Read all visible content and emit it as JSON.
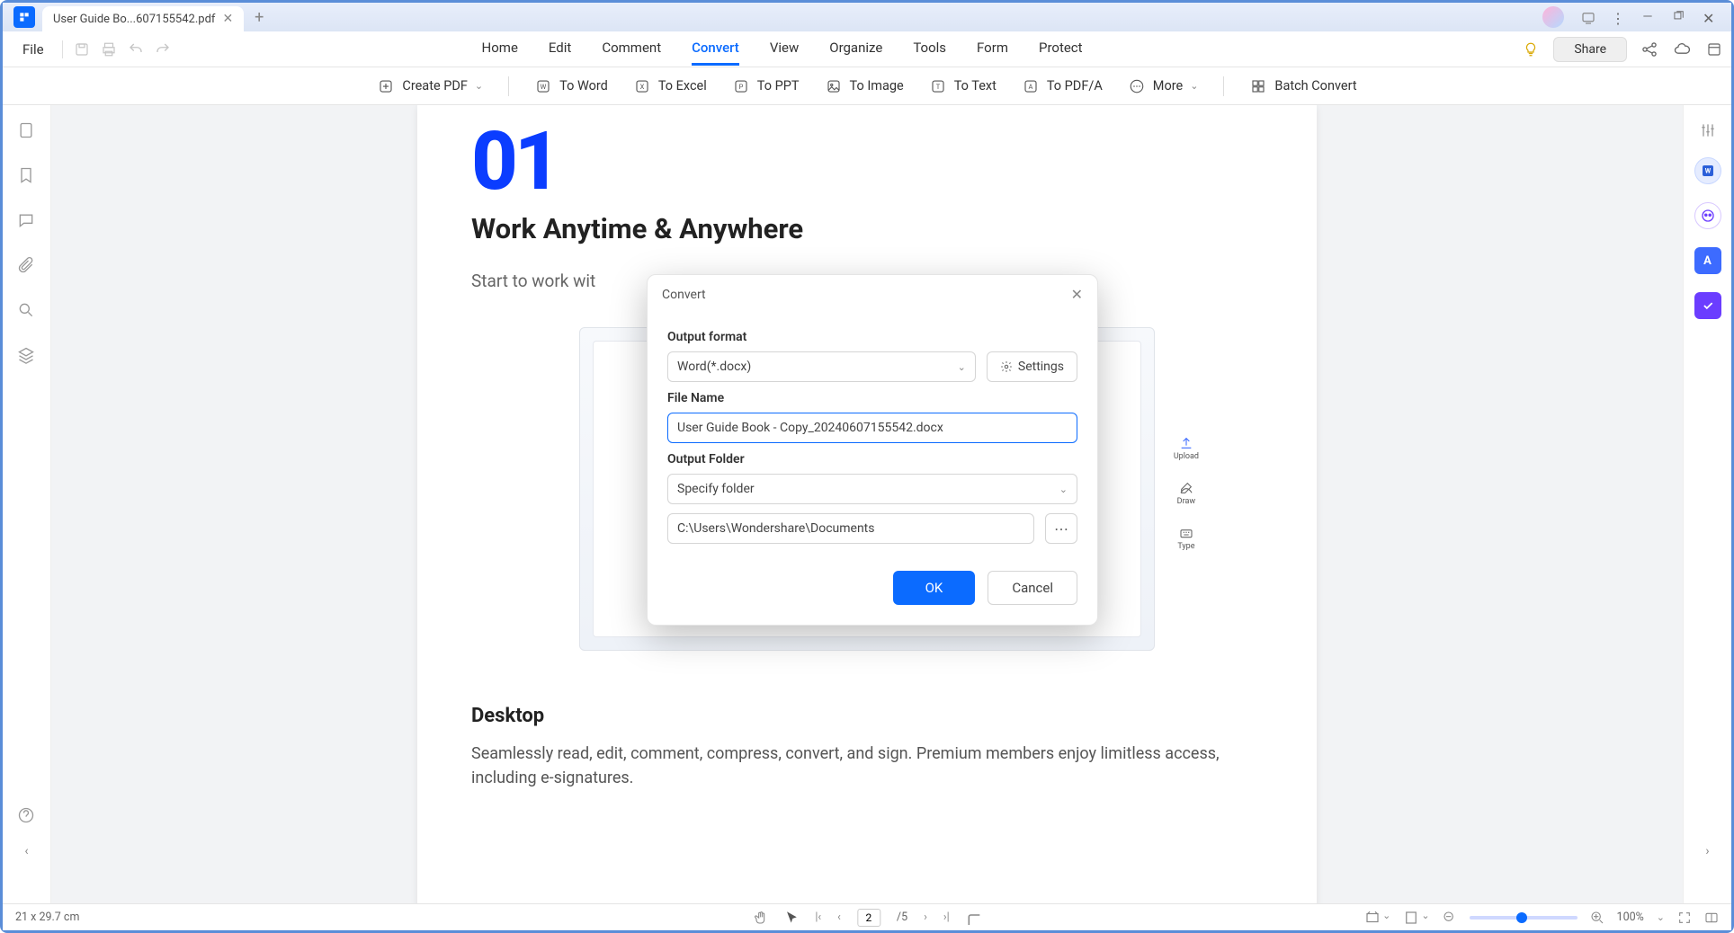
{
  "titlebar": {
    "tab_title": "User Guide Bo...607155542.pdf"
  },
  "menurow": {
    "file": "File",
    "menu": [
      "Home",
      "Edit",
      "Comment",
      "Convert",
      "View",
      "Organize",
      "Tools",
      "Form",
      "Protect"
    ],
    "active_index": 3,
    "share": "Share"
  },
  "ribbon": {
    "create_pdf": "Create PDF",
    "to_word": "To Word",
    "to_excel": "To Excel",
    "to_ppt": "To PPT",
    "to_image": "To Image",
    "to_text": "To Text",
    "to_pdfa": "To PDF/A",
    "more": "More",
    "batch": "Batch Convert"
  },
  "page": {
    "number": "01",
    "title": "Work Anytime & Anywhere",
    "subtitle_visible": "Start to work wit",
    "h2": "Desktop",
    "body": "Seamlessly read, edit, comment, compress, convert, and sign. Premium members enjoy limitless access, including e-signatures.",
    "shot_side": {
      "upload": "Upload",
      "draw": "Draw",
      "type": "Type"
    }
  },
  "dialog": {
    "title": "Convert",
    "output_format_label": "Output format",
    "output_format_value": "Word(*.docx)",
    "settings": "Settings",
    "filename_label": "File Name",
    "filename_value": "User Guide Book - Copy_20240607155542.docx",
    "output_folder_label": "Output Folder",
    "folder_mode": "Specify folder",
    "folder_path": "C:\\Users\\Wondershare\\Documents",
    "ok": "OK",
    "cancel": "Cancel"
  },
  "statusbar": {
    "dims": "21 x 29.7 cm",
    "page_current": "2",
    "page_total": "/5",
    "zoom": "100%"
  }
}
